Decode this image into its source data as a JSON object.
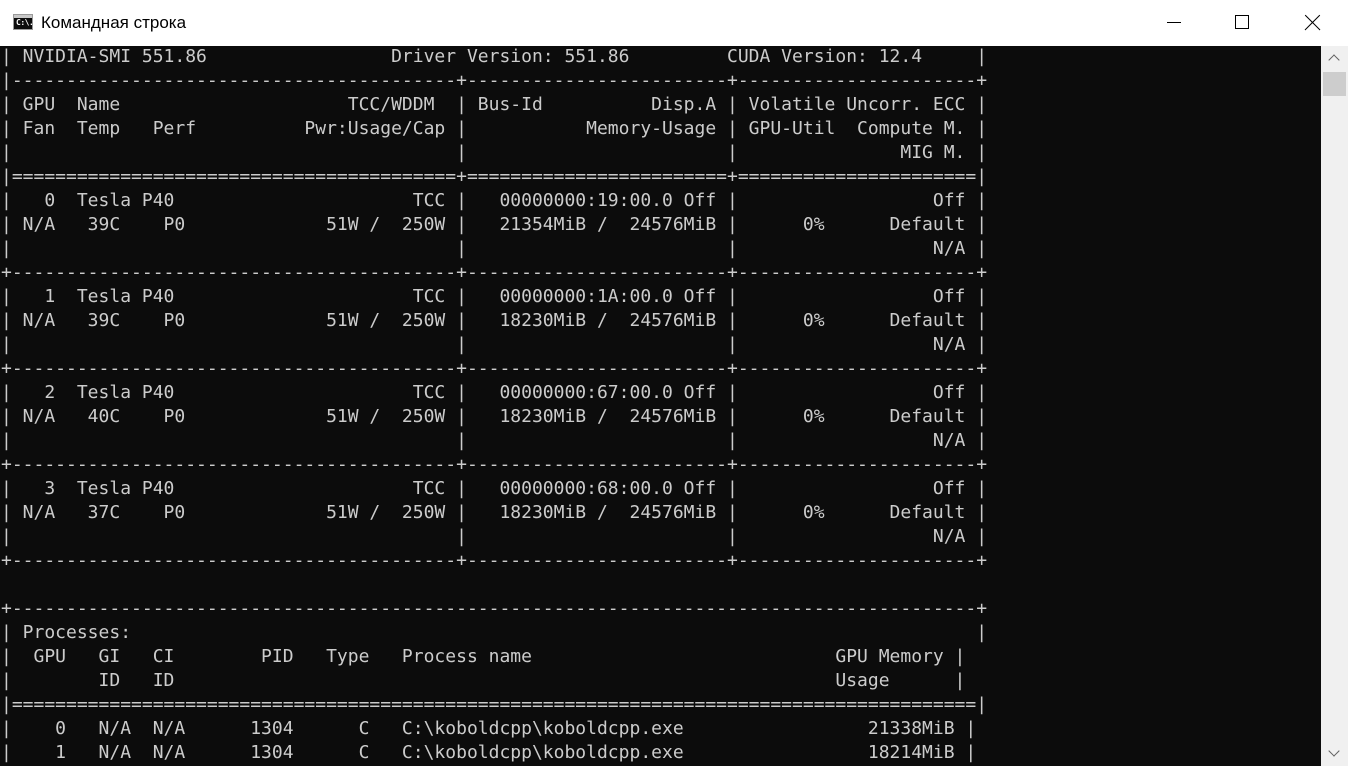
{
  "window": {
    "title": "Командная строка",
    "icon": "console-app-icon",
    "icon_text": "C:\\.",
    "buttons": {
      "minimize": "minimize-icon",
      "maximize": "maximize-icon",
      "close": "close-icon"
    }
  },
  "console": {
    "foreground": "#cccccc",
    "background": "#0c0c0c",
    "lines": [
      "| NVIDIA-SMI 551.86                 Driver Version: 551.86         CUDA Version: 12.4     |",
      "|-----------------------------------------+------------------------+----------------------+",
      "| GPU  Name                     TCC/WDDM  | Bus-Id          Disp.A | Volatile Uncorr. ECC |",
      "| Fan  Temp   Perf          Pwr:Usage/Cap |           Memory-Usage | GPU-Util  Compute M. |",
      "|                                         |                        |               MIG M. |",
      "|=========================================+========================+======================|",
      "|   0  Tesla P40                      TCC |   00000000:19:00.0 Off |                  Off |",
      "| N/A   39C    P0             51W /  250W |   21354MiB /  24576MiB |      0%      Default |",
      "|                                         |                        |                  N/A |",
      "+-----------------------------------------+------------------------+----------------------+",
      "|   1  Tesla P40                      TCC |   00000000:1A:00.0 Off |                  Off |",
      "| N/A   39C    P0             51W /  250W |   18230MiB /  24576MiB |      0%      Default |",
      "|                                         |                        |                  N/A |",
      "+-----------------------------------------+------------------------+----------------------+",
      "|   2  Tesla P40                      TCC |   00000000:67:00.0 Off |                  Off |",
      "| N/A   40C    P0             51W /  250W |   18230MiB /  24576MiB |      0%      Default |",
      "|                                         |                        |                  N/A |",
      "+-----------------------------------------+------------------------+----------------------+",
      "|   3  Tesla P40                      TCC |   00000000:68:00.0 Off |                  Off |",
      "| N/A   37C    P0             51W /  250W |   18230MiB /  24576MiB |      0%      Default |",
      "|                                         |                        |                  N/A |",
      "+-----------------------------------------+------------------------+----------------------+",
      "",
      "+-----------------------------------------------------------------------------------------+",
      "| Processes:                                                                              |",
      "|  GPU   GI   CI        PID   Type   Process name                            GPU Memory |",
      "|        ID   ID                                                             Usage      |",
      "|=========================================================================================|",
      "|    0   N/A  N/A      1304      C   C:\\koboldcpp\\koboldcpp.exe                 21338MiB |",
      "|    1   N/A  N/A      1304      C   C:\\koboldcpp\\koboldcpp.exe                 18214MiB |"
    ]
  },
  "scrollbar": {
    "up": "chevron-up-icon",
    "down": "chevron-down-icon"
  }
}
